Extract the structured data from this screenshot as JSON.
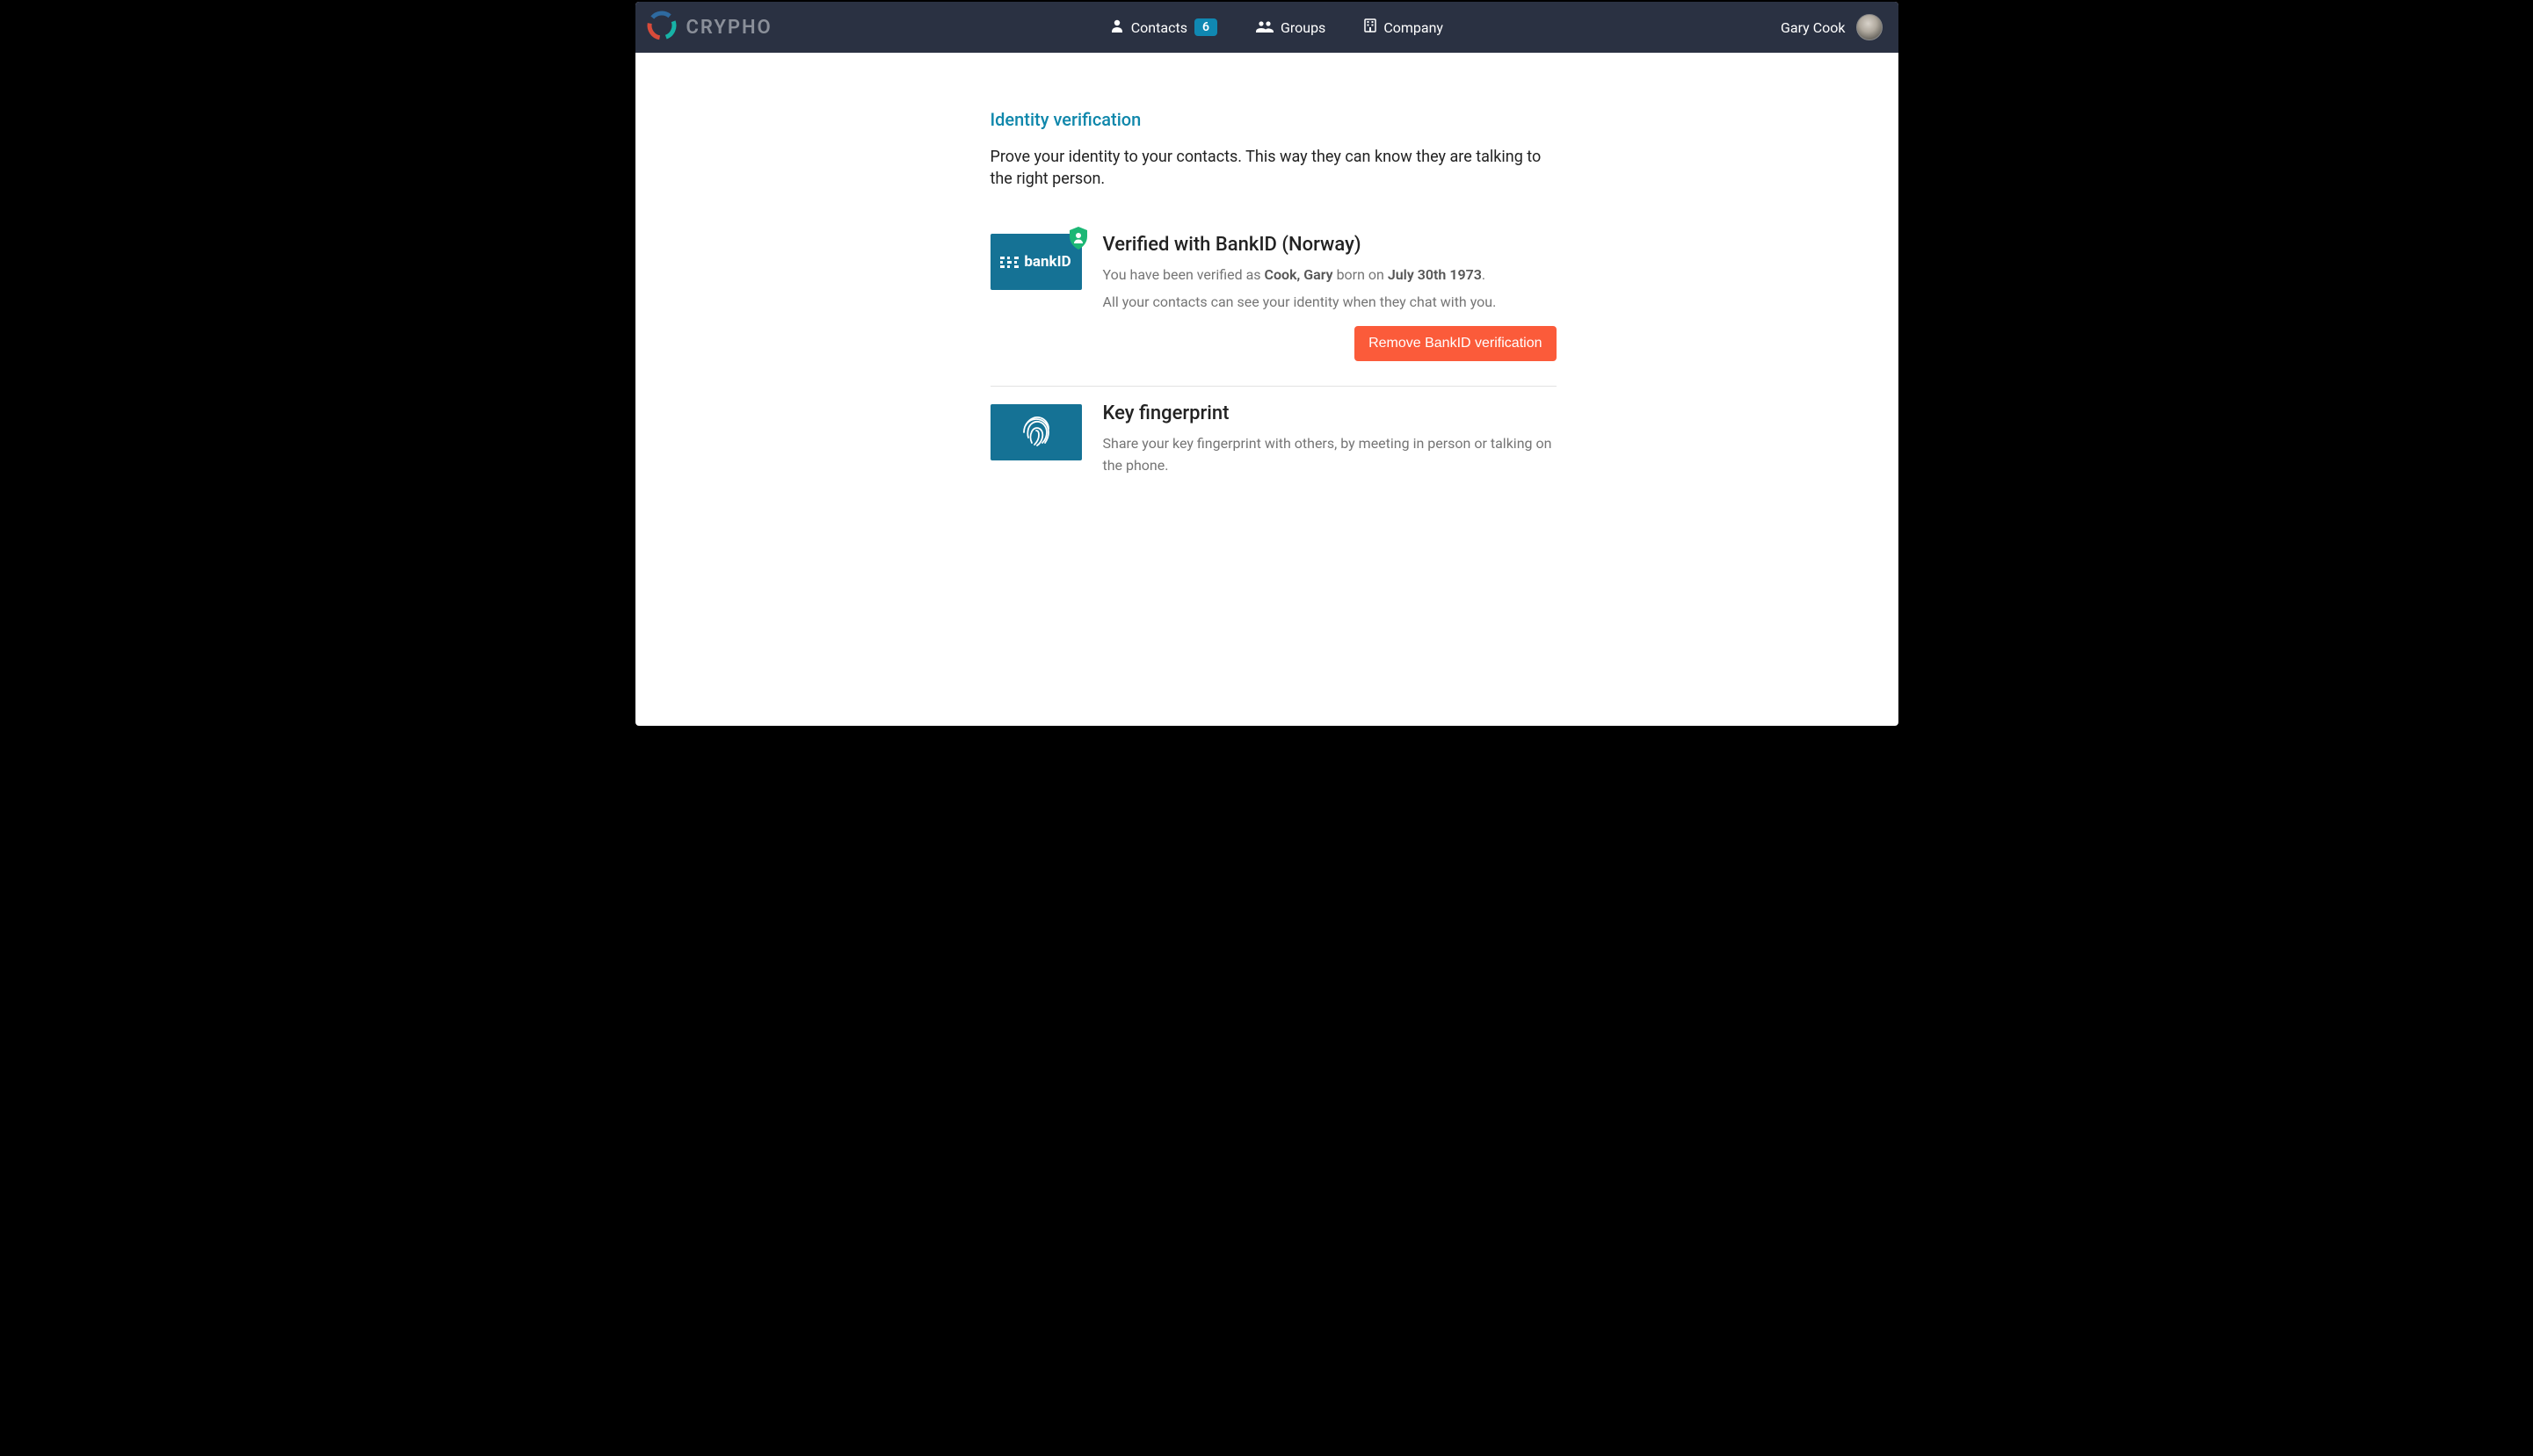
{
  "brand": {
    "name": "CRYPHO"
  },
  "nav": {
    "contacts": {
      "label": "Contacts",
      "badge": "6"
    },
    "groups": {
      "label": "Groups"
    },
    "company": {
      "label": "Company"
    }
  },
  "user": {
    "name": "Gary Cook"
  },
  "page": {
    "title": "Identity verification",
    "description": "Prove your identity to your contacts. This way they can know they are talking to the right person."
  },
  "bankid": {
    "logo_text": "bankID",
    "heading": "Verified with BankID (Norway)",
    "line1_a": "You have been verified as ",
    "line1_name": "Cook, Gary",
    "line1_b": " born on ",
    "line1_date": "July 30th 1973",
    "line1_c": ".",
    "line2": "All your contacts can see your identity when they chat with you.",
    "remove_button": "Remove BankID verification"
  },
  "fingerprint": {
    "heading": "Key fingerprint",
    "desc": "Share your key fingerprint with others, by meeting in person or talking on the phone."
  }
}
